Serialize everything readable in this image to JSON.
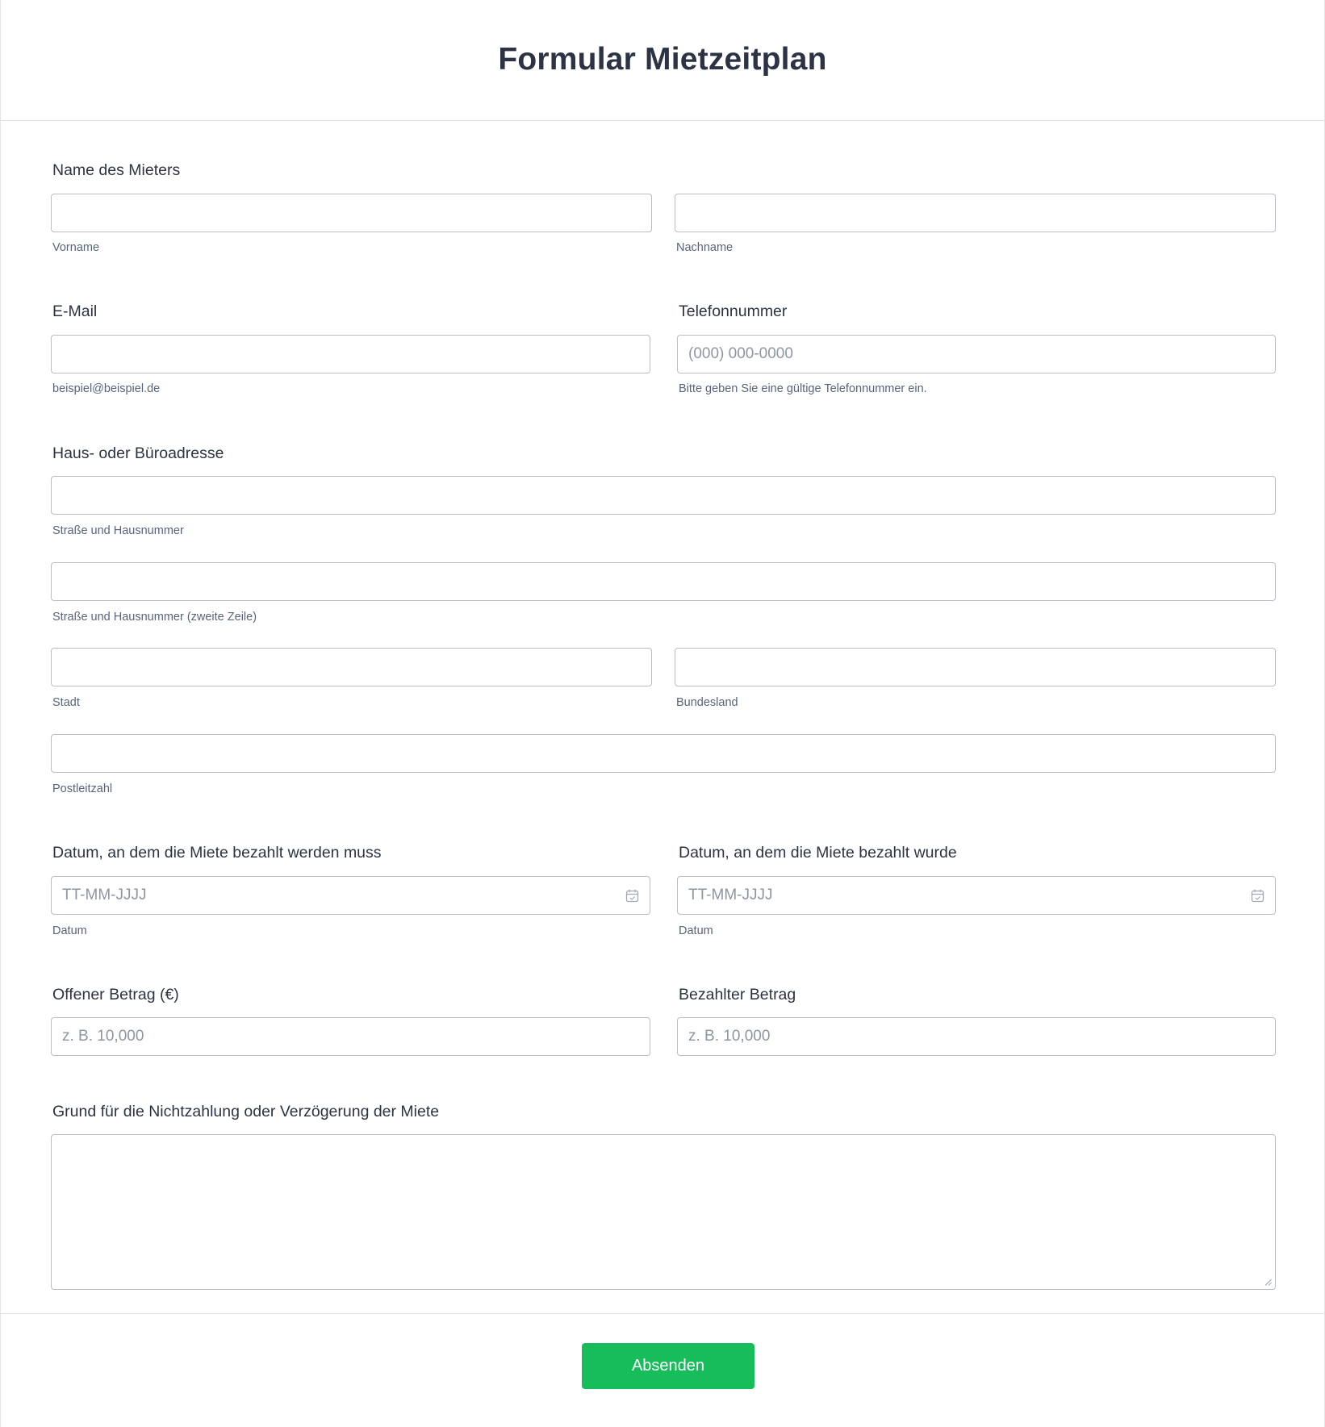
{
  "form": {
    "title": "Formular Mietzeitplan"
  },
  "tenant_name": {
    "label": "Name des Mieters",
    "first_sub": "Vorname",
    "last_sub": "Nachname"
  },
  "email": {
    "label": "E-Mail",
    "sub": "beispiel@beispiel.de"
  },
  "phone": {
    "label": "Telefonnummer",
    "placeholder": "(000) 000-0000",
    "sub": "Bitte geben Sie eine gültige Telefonnummer ein."
  },
  "address": {
    "label": "Haus- oder Büroadresse",
    "street1_sub": "Straße und Hausnummer",
    "street2_sub": "Straße und Hausnummer (zweite Zeile)",
    "city_sub": "Stadt",
    "state_sub": "Bundesland",
    "zip_sub": "Postleitzahl"
  },
  "due_date": {
    "label": "Datum, an dem die Miete bezahlt werden muss",
    "placeholder": "TT-MM-JJJJ",
    "sub": "Datum",
    "icon": "calendar-icon"
  },
  "paid_date": {
    "label": "Datum, an dem die Miete bezahlt wurde",
    "placeholder": "TT-MM-JJJJ",
    "sub": "Datum",
    "icon": "calendar-icon"
  },
  "open_amount": {
    "label": "Offener Betrag (€)",
    "placeholder": "z. B. 10,000"
  },
  "paid_amount": {
    "label": "Bezahlter Betrag",
    "placeholder": "z. B. 10,000"
  },
  "reason": {
    "label": "Grund für die Nichtzahlung oder Verzögerung der Miete"
  },
  "submit": {
    "label": "Absenden",
    "color": "#18bd5b"
  }
}
